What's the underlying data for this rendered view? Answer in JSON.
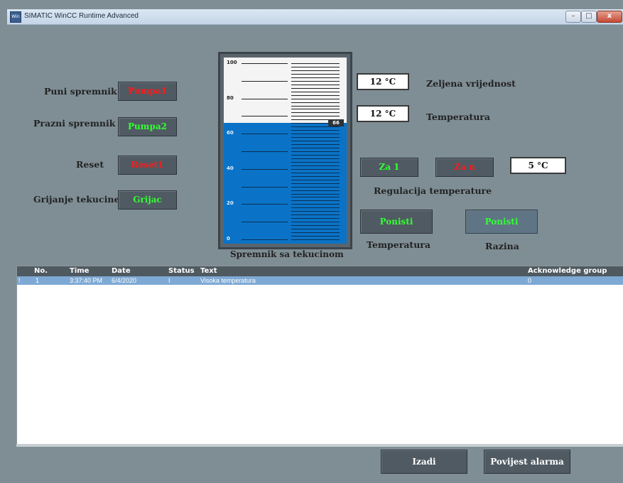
{
  "window": {
    "title": "SIMATIC WinCC Runtime Advanced",
    "app_icon": "wincc-icon",
    "controls": {
      "minimize": "–",
      "maximize": "□",
      "close": "x"
    }
  },
  "controls": {
    "puni_label": "Puni spremnik",
    "puni_button": "Pumpa1",
    "prazni_label": "Prazni spremnik",
    "prazni_button": "Pumpa2",
    "reset_label": "Reset",
    "reset_button": "Reset1",
    "grijanje_label": "Grijanje tekucine",
    "grijanje_button": "Grijac"
  },
  "tank": {
    "caption": "Spremnik sa tekucinom",
    "level": 66,
    "level_label": "66",
    "scale": [
      "100",
      "80",
      "60",
      "40",
      "20",
      "0"
    ],
    "fill_color": "#0a73c7"
  },
  "temperature": {
    "setpoint_value": "12 °C",
    "setpoint_label": "Zeljena vrijednost",
    "actual_value": "12 °C",
    "actual_label": "Temperatura",
    "za1_button": "Za 1",
    "zan_button": "Za n",
    "step_value": "5 °C",
    "regulation_label": "Regulacija temperature",
    "ponisti_temp_button": "Ponisti",
    "ponisti_temp_label": "Temperatura",
    "ponisti_level_button": "Ponisti",
    "ponisti_level_label": "Razina"
  },
  "alarm_view": {
    "columns": [
      "No.",
      "Time",
      "Date",
      "Status",
      "Text",
      "Acknowledge group"
    ],
    "rows": [
      {
        "marker": "!",
        "no": "1",
        "time": "3:37:40 PM",
        "date": "6/4/2020",
        "status": "I",
        "text": "Visoka temperatura",
        "ack": "0"
      }
    ]
  },
  "footer": {
    "izadi_button": "Izadi",
    "povijest_button": "Povijest alarma"
  },
  "colors": {
    "background": "#7f8e95",
    "button": "#505a62",
    "red_text": "#ff1a1a",
    "green_text": "#33ff33",
    "selected_row": "#7ea9d4"
  }
}
